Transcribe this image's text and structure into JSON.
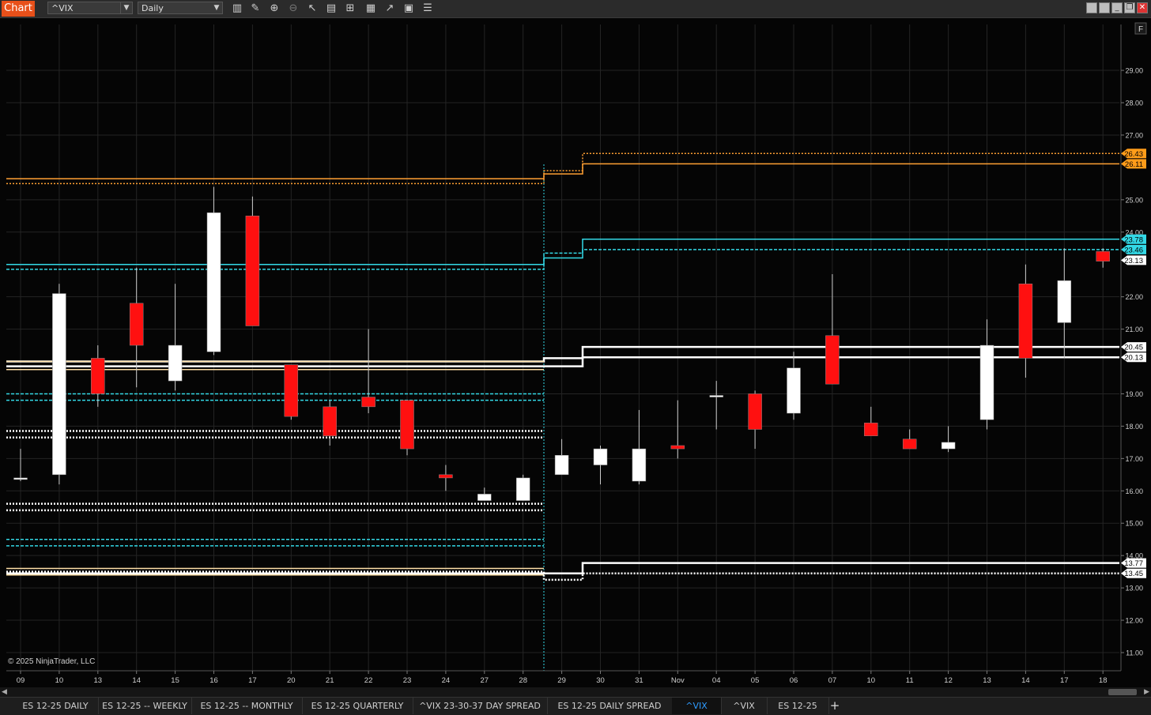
{
  "window": {
    "title": "Chart",
    "instrument": "^VIX",
    "interval": "Daily",
    "toolbar_icons": [
      "bar-type-icon",
      "draw-pencil-icon",
      "zoom-in-icon",
      "zoom-out-icon",
      "pointer-icon",
      "properties-icon",
      "templates-icon",
      "indicators-icon",
      "strategies-icon",
      "data-box-icon",
      "more-icon"
    ],
    "controls": [
      "minimize-icon",
      "restore-icon",
      "close-icon"
    ]
  },
  "chart": {
    "copyright": "© 2025 NinjaTrader, LLC",
    "corner_label": "F",
    "ylim": [
      10.5,
      30.0
    ],
    "y_ticks": [
      "29.00",
      "28.00",
      "27.00",
      "25.00",
      "24.00",
      "22.00",
      "21.00",
      "19.00",
      "18.00",
      "17.00",
      "16.00",
      "15.00",
      "14.00",
      "13.00",
      "12.00",
      "11.00"
    ],
    "x_labels": [
      "09",
      "10",
      "13",
      "14",
      "15",
      "16",
      "17",
      "20",
      "21",
      "22",
      "23",
      "24",
      "27",
      "28",
      "29",
      "30",
      "31",
      "Nov",
      "04",
      "05",
      "06",
      "07",
      "10",
      "11",
      "12",
      "13",
      "14",
      "17",
      "18"
    ],
    "candles": [
      {
        "d": "09",
        "o": 16.4,
        "h": 17.3,
        "l": 16.3,
        "c": 16.4
      },
      {
        "d": "10",
        "o": 16.5,
        "h": 22.4,
        "l": 16.2,
        "c": 22.1
      },
      {
        "d": "13",
        "o": 20.1,
        "h": 20.5,
        "l": 18.6,
        "c": 19.0
      },
      {
        "d": "14",
        "o": 21.8,
        "h": 22.9,
        "l": 19.2,
        "c": 20.5
      },
      {
        "d": "15",
        "o": 19.4,
        "h": 22.4,
        "l": 19.1,
        "c": 20.5
      },
      {
        "d": "16",
        "o": 20.3,
        "h": 25.4,
        "l": 20.2,
        "c": 24.6
      },
      {
        "d": "17",
        "o": 24.5,
        "h": 25.1,
        "l": 21.1,
        "c": 21.1
      },
      {
        "d": "20",
        "o": 19.9,
        "h": 19.9,
        "l": 18.2,
        "c": 18.3
      },
      {
        "d": "21",
        "o": 18.6,
        "h": 18.8,
        "l": 17.4,
        "c": 17.7
      },
      {
        "d": "22",
        "o": 18.9,
        "h": 21.0,
        "l": 18.4,
        "c": 18.6
      },
      {
        "d": "23",
        "o": 18.8,
        "h": 18.8,
        "l": 17.1,
        "c": 17.3
      },
      {
        "d": "24",
        "o": 16.5,
        "h": 16.8,
        "l": 16.0,
        "c": 16.4
      },
      {
        "d": "27",
        "o": 15.7,
        "h": 16.1,
        "l": 15.7,
        "c": 15.9
      },
      {
        "d": "28",
        "o": 15.7,
        "h": 16.5,
        "l": 15.7,
        "c": 16.4
      },
      {
        "d": "29",
        "o": 16.5,
        "h": 17.6,
        "l": 16.5,
        "c": 17.1
      },
      {
        "d": "30",
        "o": 16.8,
        "h": 17.4,
        "l": 16.2,
        "c": 17.3
      },
      {
        "d": "31",
        "o": 16.3,
        "h": 18.5,
        "l": 16.2,
        "c": 17.3
      },
      {
        "d": "Nov",
        "o": 17.4,
        "h": 18.8,
        "l": 17.0,
        "c": 17.3
      },
      {
        "d": "04",
        "o": 18.95,
        "h": 19.4,
        "l": 17.9,
        "c": 18.95
      },
      {
        "d": "05",
        "o": 19.0,
        "h": 19.1,
        "l": 17.3,
        "c": 17.9
      },
      {
        "d": "06",
        "o": 18.4,
        "h": 20.3,
        "l": 18.2,
        "c": 19.8
      },
      {
        "d": "07",
        "o": 20.8,
        "h": 22.7,
        "l": 19.3,
        "c": 19.3
      },
      {
        "d": "10",
        "o": 18.1,
        "h": 18.6,
        "l": 17.7,
        "c": 17.7
      },
      {
        "d": "11",
        "o": 17.6,
        "h": 17.9,
        "l": 17.3,
        "c": 17.3
      },
      {
        "d": "12",
        "o": 17.3,
        "h": 18.0,
        "l": 17.2,
        "c": 17.5
      },
      {
        "d": "13",
        "o": 18.2,
        "h": 21.3,
        "l": 17.9,
        "c": 20.5
      },
      {
        "d": "14",
        "o": 22.4,
        "h": 23.0,
        "l": 19.5,
        "c": 20.1
      },
      {
        "d": "17",
        "o": 21.2,
        "h": 23.5,
        "l": 20.1,
        "c": 22.5
      },
      {
        "d": "18",
        "o": 23.4,
        "h": 23.5,
        "l": 22.9,
        "c": 23.1
      }
    ],
    "colors": {
      "up": "#ffffff",
      "down": "#ff1010",
      "orange": "#ffa033",
      "cyan": "#33d9e6",
      "white": "#ffffff",
      "pale": "#ffe0a8",
      "grid": "#242424",
      "axis_text": "#cfcfcf",
      "background": "#050505",
      "session_marker": "#33d9e6"
    },
    "levels": [
      {
        "color": "orange",
        "style": "solid",
        "prev": 25.65,
        "curr1": 25.8,
        "curr2": 26.11
      },
      {
        "color": "orange",
        "style": "dotted",
        "prev": 25.5,
        "curr1": 25.9,
        "curr2": 26.43
      },
      {
        "color": "cyan",
        "style": "solid",
        "prev": 23.0,
        "curr1": 23.2,
        "curr2": 23.78
      },
      {
        "color": "cyan",
        "style": "dashed",
        "prev": 22.85,
        "curr1": 23.35,
        "curr2": 23.46
      },
      {
        "color": "white",
        "style": "solid",
        "prev": 20.0,
        "curr1": 20.1,
        "curr2": 20.45
      },
      {
        "color": "white",
        "style": "solid",
        "prev": 19.85,
        "curr1": 19.85,
        "curr2": 20.13
      },
      {
        "color": "pale",
        "style": "solid",
        "prev": 20.0
      },
      {
        "color": "pale",
        "style": "solid",
        "prev": 19.75
      },
      {
        "color": "cyan",
        "style": "dashed",
        "prev": 19.0
      },
      {
        "color": "cyan",
        "style": "dashed",
        "prev": 18.8
      },
      {
        "color": "white",
        "style": "dotted",
        "prev": 17.85
      },
      {
        "color": "white",
        "style": "dotted",
        "prev": 17.65
      },
      {
        "color": "white",
        "style": "dotted",
        "prev": 15.6
      },
      {
        "color": "white",
        "style": "dotted",
        "prev": 15.4
      },
      {
        "color": "cyan",
        "style": "dashed",
        "prev": 14.5
      },
      {
        "color": "cyan",
        "style": "dashed",
        "prev": 14.3
      },
      {
        "color": "pale",
        "style": "solid",
        "prev": 13.6
      },
      {
        "color": "pale",
        "style": "solid",
        "prev": 13.4
      },
      {
        "color": "white",
        "style": "solid",
        "prev": 13.45,
        "curr1": 13.45,
        "curr2": 13.77
      },
      {
        "color": "white",
        "style": "dotted",
        "prev": 13.5,
        "curr1": 13.25,
        "curr2": 13.45
      }
    ],
    "price_markers": [
      {
        "label": "26.43",
        "value": 26.43,
        "bg": "#ff9c1a",
        "fg": "#000"
      },
      {
        "label": "26.11",
        "value": 26.11,
        "bg": "#ff9c1a",
        "fg": "#000"
      },
      {
        "label": "23.78",
        "value": 23.78,
        "bg": "#33d9e6",
        "fg": "#000"
      },
      {
        "label": "23.46",
        "value": 23.46,
        "bg": "#33d9e6",
        "fg": "#000"
      },
      {
        "label": "23.13",
        "value": 23.13,
        "bg": "#ffffff",
        "fg": "#000"
      },
      {
        "label": "20.45",
        "value": 20.45,
        "bg": "#ffffff",
        "fg": "#000"
      },
      {
        "label": "20.13",
        "value": 20.13,
        "bg": "#ffffff",
        "fg": "#000"
      },
      {
        "label": "13.77",
        "value": 13.77,
        "bg": "#ffffff",
        "fg": "#000"
      },
      {
        "label": "13.45",
        "value": 13.45,
        "bg": "#ffffff",
        "fg": "#000"
      }
    ]
  },
  "tabs": [
    {
      "label": "ES 12-25 DAILY",
      "active": false
    },
    {
      "label": "ES 12-25 -- WEEKLY",
      "active": false
    },
    {
      "label": "ES 12-25 -- MONTHLY",
      "active": false
    },
    {
      "label": "ES 12-25 QUARTERLY",
      "active": false
    },
    {
      "label": "^VIX 23-30-37 DAY SPREAD",
      "active": false
    },
    {
      "label": "ES 12-25 DAILY SPREAD",
      "active": false
    },
    {
      "label": "^VIX",
      "active": true
    },
    {
      "label": "^VIX",
      "active": false
    },
    {
      "label": "ES 12-25",
      "active": false
    }
  ],
  "add_tab_label": "+"
}
